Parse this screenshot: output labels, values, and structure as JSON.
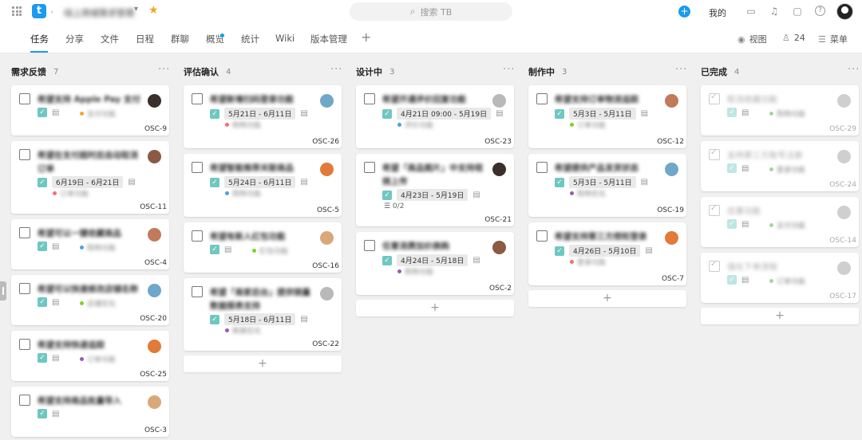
{
  "topbar": {
    "project_name": "线上商城需求管理",
    "search_placeholder": "搜索 TB",
    "mine_label": "我的"
  },
  "tabs": [
    "任务",
    "分享",
    "文件",
    "日程",
    "群聊",
    "概览",
    "统计",
    "Wiki",
    "版本管理"
  ],
  "nav_right": {
    "view_label": "视图",
    "member_count": "24",
    "menu_label": "菜单"
  },
  "colors": {
    "accent": "#1b9aee",
    "check_teal": "#6fc7c1",
    "star": "#f5a623"
  },
  "columns": [
    {
      "title": "需求反馈",
      "count": "7",
      "cards": [
        {
          "title": "希望支持 Apple Pay 支付",
          "tag": "支付功能",
          "id": "OSC-9"
        },
        {
          "title": "希望在支付超时后自动取消订单",
          "date": "6月19日 - 6月21日",
          "tag": "订单功能",
          "id": "OSC-11"
        },
        {
          "title": "希望可以一键收藏商品",
          "tag": "购物功能",
          "id": "OSC-4"
        },
        {
          "title": "希望可以快速修改店铺名称",
          "tag": "店铺优化",
          "id": "OSC-20"
        },
        {
          "title": "希望支持快递追踪",
          "tag": "订单功能",
          "id": "OSC-25"
        },
        {
          "title": "希望支持商品批量导入",
          "id": "OSC-3"
        }
      ]
    },
    {
      "title": "评估确认",
      "count": "4",
      "cards": [
        {
          "title": "希望新增扫码登录功能",
          "date": "5月21日 - 6月11日",
          "tag": "购物功能",
          "id": "OSC-26"
        },
        {
          "title": "希望智能推荐关联商品",
          "date": "5月24日 - 6月11日",
          "tag": "购物功能",
          "id": "OSC-5"
        },
        {
          "title": "希望有新人红包功能",
          "tag": "红包功能",
          "id": "OSC-16"
        },
        {
          "title": "希望「商家后台」提供销量数据报表支持",
          "date": "5月18日 - 6月11日",
          "tag": "数据优化",
          "id": "OSC-22"
        }
      ],
      "add_label": "+"
    },
    {
      "title": "设计中",
      "count": "3",
      "cards": [
        {
          "title": "希望开通评价回复功能",
          "date": "4月21日 09:00 - 5月19日",
          "tag": "评价功能",
          "id": "OSC-23"
        },
        {
          "title": "希望「商品图片」中支持视频上传",
          "date": "4月23日 - 5月19日",
          "subtasks": "0/2",
          "id": "OSC-21"
        },
        {
          "title": "任意消费加价换购",
          "date": "4月24日 - 5月18日",
          "tag": "购物功能",
          "id": "OSC-2"
        }
      ],
      "add_label": "+"
    },
    {
      "title": "制作中",
      "count": "3",
      "cards": [
        {
          "title": "希望支持订单物流追踪",
          "date": "5月3日 - 5月11日",
          "tag": "订单功能",
          "id": "OSC-12"
        },
        {
          "title": "希望提供产品发货状态",
          "date": "5月3日 - 5月11日",
          "tag": "购物优化",
          "id": "OSC-19"
        },
        {
          "title": "希望支持第三方授权登录",
          "date": "4月26日 - 5月10日",
          "tag": "登录功能",
          "id": "OSC-7"
        }
      ],
      "add_label": "+"
    },
    {
      "title": "已完成",
      "count": "4",
      "cards": [
        {
          "title": "取消收藏功能",
          "tag": "购物功能",
          "id": "OSC-29"
        },
        {
          "title": "支持第三方账号注册",
          "tag": "登录功能",
          "id": "OSC-24"
        },
        {
          "title": "优惠功能",
          "tag": "支付功能",
          "id": "OSC-14"
        },
        {
          "title": "强化下单流程",
          "tag": "订单功能",
          "id": "OSC-17"
        }
      ],
      "add_label": "+"
    }
  ]
}
